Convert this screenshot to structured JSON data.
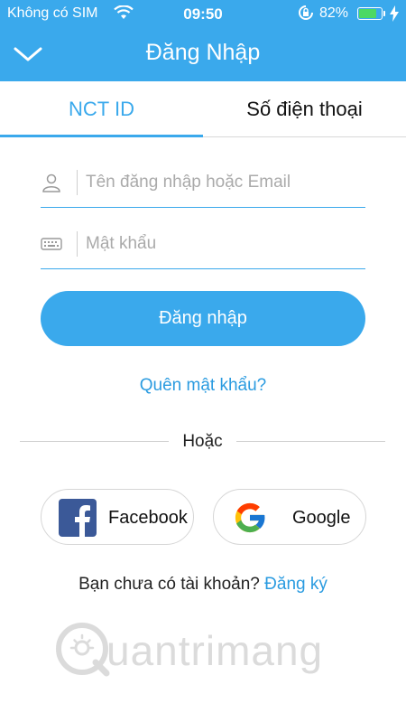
{
  "status_bar": {
    "carrier": "Không có SIM",
    "time": "09:50",
    "battery_percent": "82%",
    "battery_level": 0.82,
    "wifi_icon": "wifi-icon",
    "rotation_lock_icon": "rotation-lock-icon",
    "charging_icon": "charging-bolt-icon"
  },
  "nav": {
    "title": "Đăng Nhập",
    "back_icon": "chevron-down-icon"
  },
  "tabs": [
    {
      "label": "NCT ID",
      "active": true
    },
    {
      "label": "Số điện thoại",
      "active": false
    }
  ],
  "form": {
    "username_placeholder": "Tên đăng nhập hoặc Email",
    "username_value": "",
    "username_icon": "user-icon",
    "password_placeholder": "Mật khẩu",
    "password_value": "",
    "password_icon": "keyboard-icon",
    "login_label": "Đăng nhập",
    "forgot_label": "Quên mật khẩu?"
  },
  "divider": {
    "label": "Hoặc"
  },
  "social": {
    "facebook_label": "Facebook",
    "google_label": "Google"
  },
  "signup": {
    "prompt": "Bạn chưa có tài khoản?",
    "link": "Đăng ký"
  },
  "watermark": {
    "text": "uantrimang"
  },
  "colors": {
    "accent": "#3aa9ec",
    "link": "#2a9be0",
    "facebook": "#3b5998",
    "battery": "#4cd964"
  }
}
